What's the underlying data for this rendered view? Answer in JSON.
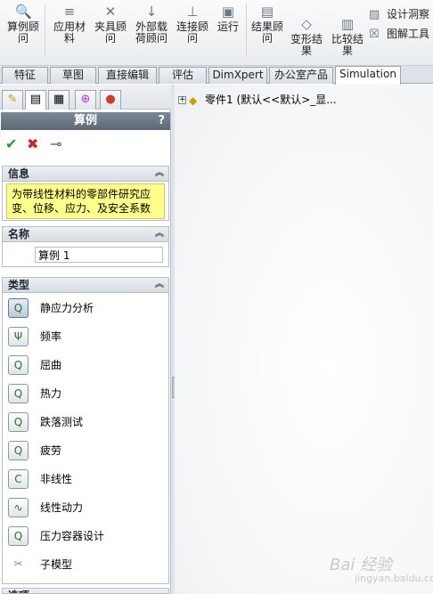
{
  "ribbon": {
    "buttons": [
      {
        "label": "算例顾问",
        "icon": "study-advisor-icon",
        "icon_glyph": "🔍"
      },
      {
        "label": "应用材料",
        "icon": "apply-material-icon",
        "icon_glyph": "≡"
      },
      {
        "label": "夹具顾问",
        "icon": "fixtures-advisor-icon",
        "icon_glyph": "✕"
      },
      {
        "label": "外部载荷顾问",
        "icon": "external-loads-advisor-icon",
        "icon_glyph": "↓"
      },
      {
        "label": "连接顾问",
        "icon": "connections-advisor-icon",
        "icon_glyph": "⊥"
      },
      {
        "label": "运行",
        "icon": "run-icon",
        "icon_glyph": "▣"
      },
      {
        "label": "结果顾问",
        "icon": "results-advisor-icon",
        "icon_glyph": "▤"
      },
      {
        "label": "变形结果",
        "icon": "deformed-result-icon",
        "icon_glyph": "◇"
      },
      {
        "label": "比较结果",
        "icon": "compare-results-icon",
        "icon_glyph": "▥"
      }
    ],
    "small_buttons": [
      {
        "label": "设计洞察",
        "icon": "design-insight-icon",
        "icon_glyph": "▧"
      },
      {
        "label": "图解工具",
        "icon": "plot-tools-icon",
        "icon_glyph": "☒"
      }
    ]
  },
  "tabs": [
    "特征",
    "草图",
    "直接编辑",
    "评估",
    "DimXpert",
    "办公室产品",
    "Simulation"
  ],
  "active_tab": "Simulation",
  "manager_tabs": [
    {
      "name": "featuremanager-tab",
      "glyph": "✎"
    },
    {
      "name": "propertymanager-tab",
      "glyph": "▤"
    },
    {
      "name": "configurationmanager-tab",
      "glyph": "▦"
    },
    {
      "name": "dimxpertmanager-tab",
      "glyph": "⊕"
    },
    {
      "name": "displaymanager-tab",
      "glyph": "●"
    }
  ],
  "property_manager": {
    "title": "算例",
    "help": "?",
    "ok_glyph": "✔",
    "cancel_glyph": "✖",
    "pin_glyph": "⊸",
    "info": {
      "header": "信息",
      "text": "为带线性材料的零部件研究应变、位移、应力、及安全系数"
    },
    "name": {
      "header": "名称",
      "value": "算例 1"
    },
    "type": {
      "header": "类型",
      "items": [
        {
          "label": "静应力分析",
          "icon": "static-analysis-icon",
          "glyph": "Q"
        },
        {
          "label": "频率",
          "icon": "frequency-icon",
          "glyph": "Ψ"
        },
        {
          "label": "屈曲",
          "icon": "buckling-icon",
          "glyph": "Q"
        },
        {
          "label": "热力",
          "icon": "thermal-icon",
          "glyph": "Q"
        },
        {
          "label": "跌落测试",
          "icon": "drop-test-icon",
          "glyph": "Q"
        },
        {
          "label": "疲劳",
          "icon": "fatigue-icon",
          "glyph": "Q"
        },
        {
          "label": "非线性",
          "icon": "nonlinear-icon",
          "glyph": "C"
        },
        {
          "label": "线性动力",
          "icon": "linear-dynamic-icon",
          "glyph": "∿"
        },
        {
          "label": "压力容器设计",
          "icon": "pressure-vessel-icon",
          "glyph": "Q"
        },
        {
          "label": "子模型",
          "icon": "submodel-icon",
          "glyph": "✂"
        }
      ]
    },
    "options_header": "选项"
  },
  "graphics": {
    "tree_root": "零件1  (默认<<默认>_显..."
  },
  "watermark": {
    "text": "Bai 经验",
    "url": "jingyan.baidu.com"
  }
}
